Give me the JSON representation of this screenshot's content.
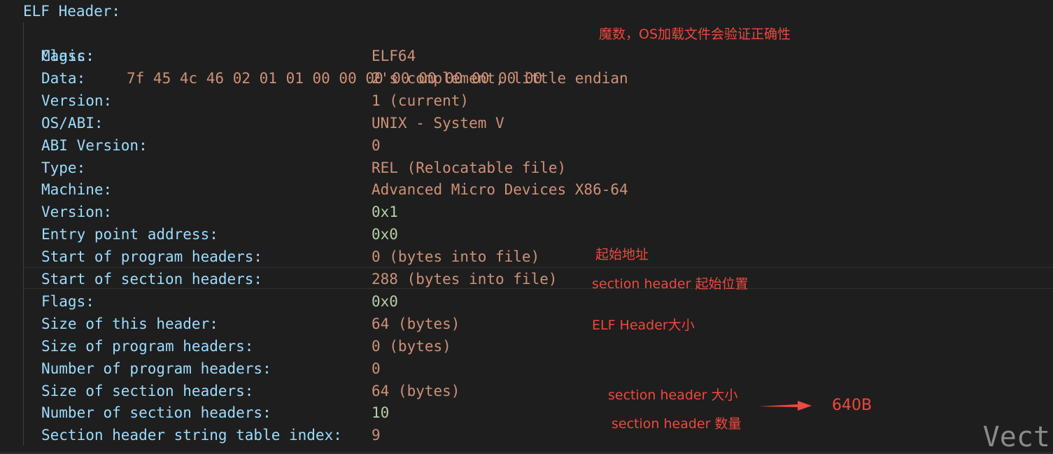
{
  "root_label": "ELF Header:",
  "magic": {
    "key": "Magic:",
    "value": "7f 45 4c 46 02 01 01 00 00 00 00 00 00 00 00 00"
  },
  "rows": [
    {
      "key": "Class:",
      "value": "ELF64",
      "numeric": false
    },
    {
      "key": "Data:",
      "value": "2's complement, little endian",
      "numeric": false
    },
    {
      "key": "Version:",
      "value": "1 (current)",
      "numeric": false
    },
    {
      "key": "OS/ABI:",
      "value": "UNIX - System V",
      "numeric": false
    },
    {
      "key": "ABI Version:",
      "value": "0",
      "numeric": false
    },
    {
      "key": "Type:",
      "value": "REL (Relocatable file)",
      "numeric": false
    },
    {
      "key": "Machine:",
      "value": "Advanced Micro Devices X86-64",
      "numeric": false
    },
    {
      "key": "Version:",
      "value": "0x1",
      "numeric": true
    },
    {
      "key": "Entry point address:",
      "value": "0x0",
      "numeric": true
    },
    {
      "key": "Start of program headers:",
      "value": "0 (bytes into file)",
      "numeric": false
    },
    {
      "key": "Start of section headers:",
      "value": "288 (bytes into file)",
      "numeric": false
    },
    {
      "key": "Flags:",
      "value": "0x0",
      "numeric": true
    },
    {
      "key": "Size of this header:",
      "value": "64 (bytes)",
      "numeric": false
    },
    {
      "key": "Size of program headers:",
      "value": "0 (bytes)",
      "numeric": false
    },
    {
      "key": "Number of program headers:",
      "value": "0",
      "numeric": false
    },
    {
      "key": "Size of section headers:",
      "value": "64 (bytes)",
      "numeric": false
    },
    {
      "key": "Number of section headers:",
      "value": "10",
      "numeric": true
    },
    {
      "key": "Section header string table index:",
      "value": "9",
      "numeric": false
    }
  ],
  "annotations": {
    "magic_note": "魔数，OS加载文件会验证正确性",
    "program_start_note": "起始地址",
    "section_start_note": "section header 起始位置",
    "header_size_note": "ELF Header大小",
    "section_size_note": "section header 大小",
    "section_count_note": "section header 数量",
    "total_note": "640B"
  },
  "watermark": "Vect",
  "colors": {
    "background": "#1e1e1e",
    "key": "#9cdcfe",
    "string_value": "#ce9178",
    "numeric_value": "#b5cea8",
    "annotation": "#f0483e"
  }
}
